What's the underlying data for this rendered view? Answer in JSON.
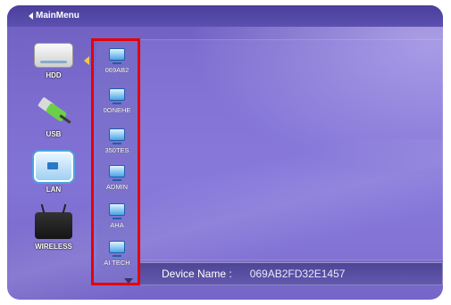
{
  "menu": {
    "back_label": "MainMenu"
  },
  "sources": [
    {
      "label": "HDD",
      "icon": "hdd-icon"
    },
    {
      "label": "USB",
      "icon": "usb-icon"
    },
    {
      "label": "LAN",
      "icon": "lan-icon"
    },
    {
      "label": "WIRELESS",
      "icon": "wireless-icon"
    }
  ],
  "devices": [
    {
      "label": "069AB2",
      "icon": "monitor-icon"
    },
    {
      "label": "0ONEHE",
      "icon": "monitor-icon"
    },
    {
      "label": "350TES",
      "icon": "monitor-icon"
    },
    {
      "label": "ADMIN",
      "icon": "monitor-icon"
    },
    {
      "label": "AHA",
      "icon": "monitor-icon"
    },
    {
      "label": "AI TECH",
      "icon": "monitor-icon"
    }
  ],
  "details": {
    "device_name_label": "Device Name :",
    "device_name_value": "069AB2FD32E1457"
  },
  "colors": {
    "highlight_border": "#e60000",
    "selector_arrow": "#f5c842",
    "background": "#7d6dd0"
  }
}
